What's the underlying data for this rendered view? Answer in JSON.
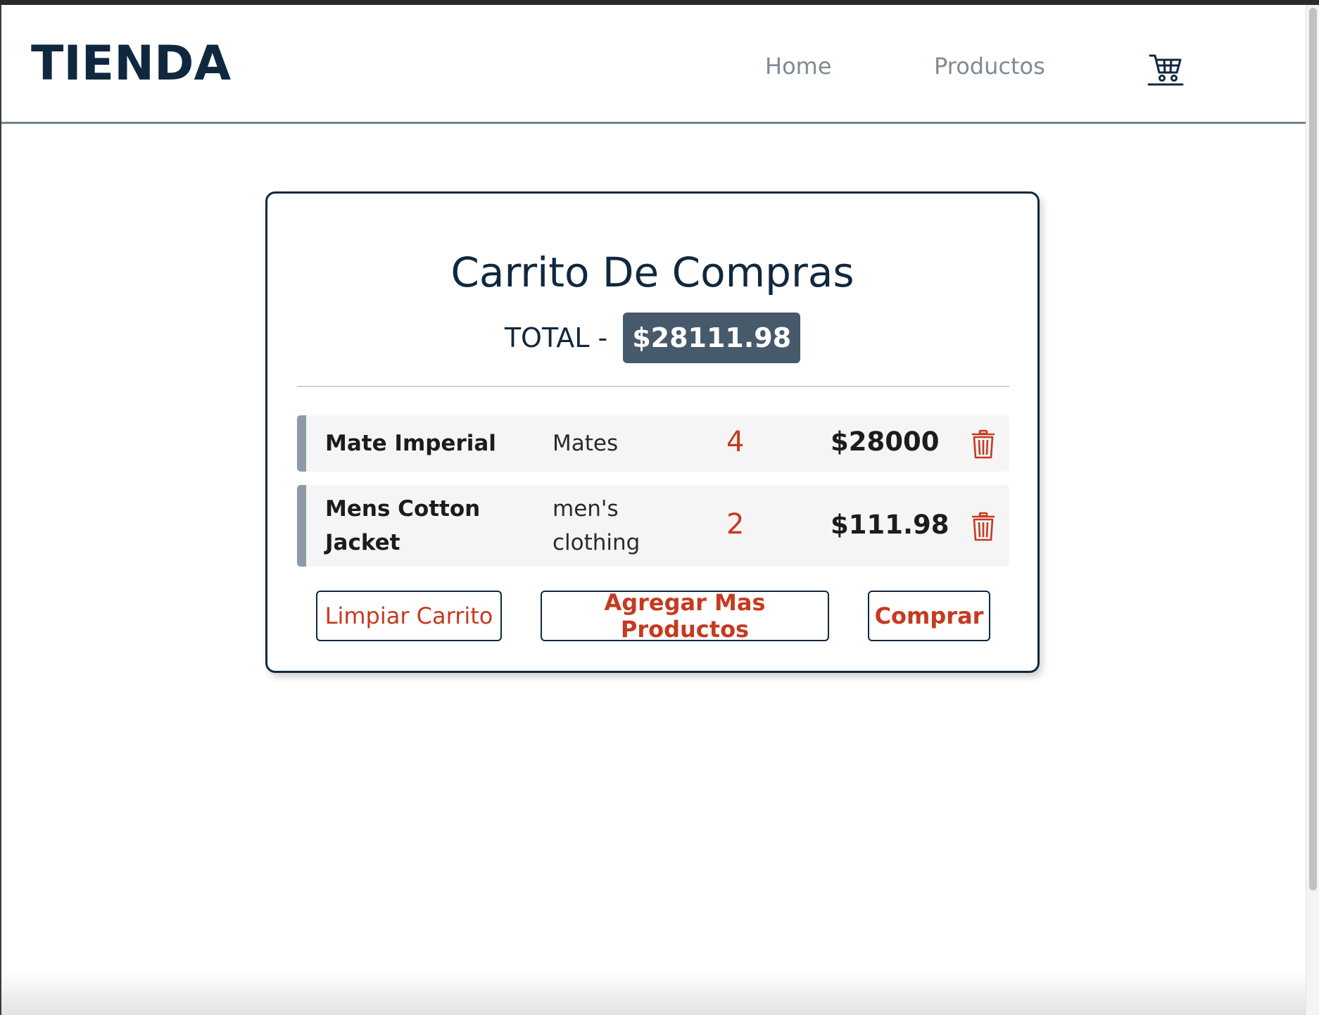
{
  "header": {
    "brand": "TIENDA",
    "nav": [
      {
        "label": "Home"
      },
      {
        "label": "Productos"
      }
    ],
    "cart_icon": "shopping-cart-icon"
  },
  "cart": {
    "title": "Carrito De Compras",
    "total_label": "TOTAL -",
    "total_value": "$28111.98",
    "items": [
      {
        "name": "Mate Imperial",
        "category": "Mates",
        "quantity": "4",
        "price": "$28000",
        "delete_icon": "trash-icon"
      },
      {
        "name": "Mens Cotton Jacket",
        "category": "men's clothing",
        "quantity": "2",
        "price": "$111.98",
        "delete_icon": "trash-icon"
      }
    ],
    "buttons": {
      "clear": "Limpiar Carrito",
      "add_more": "Agregar Mas Productos",
      "buy": "Comprar"
    }
  },
  "colors": {
    "brand_dark": "#10283f",
    "accent_red": "#c63a1f",
    "badge_bg": "#475a6b",
    "row_bar": "#8e9ba6",
    "row_bg": "#f5f5f5"
  }
}
